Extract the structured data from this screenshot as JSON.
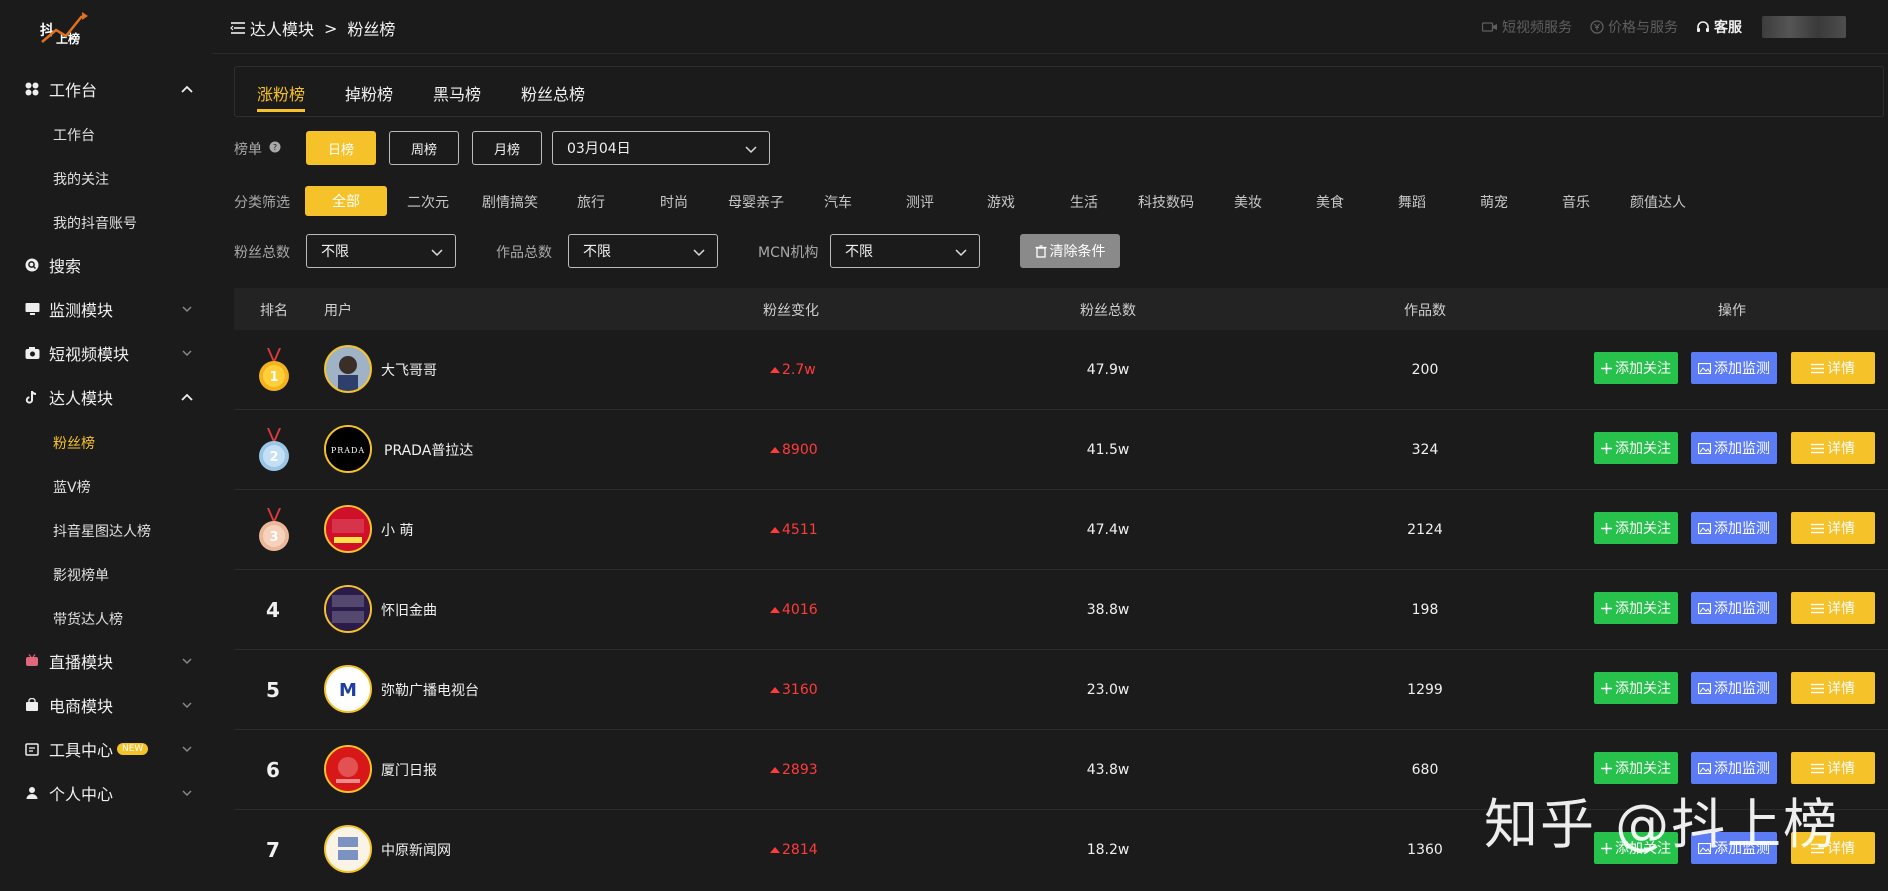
{
  "logo": {
    "line1": "抖",
    "line2": "上榜"
  },
  "sidebar": {
    "sections": [
      {
        "label": "工作台",
        "icon": "grid-icon",
        "expanded": true
      },
      {
        "label": "搜索",
        "icon": "search-icon"
      },
      {
        "label": "监测模块",
        "icon": "monitor-icon",
        "expanded": false
      },
      {
        "label": "短视频模块",
        "icon": "camera-icon",
        "expanded": false
      },
      {
        "label": "达人模块",
        "icon": "tiktok-icon",
        "expanded": true
      },
      {
        "label": "直播模块",
        "icon": "live-icon",
        "expanded": false
      },
      {
        "label": "电商模块",
        "icon": "bag-icon",
        "expanded": false
      },
      {
        "label": "工具中心",
        "icon": "tool-icon",
        "badge": "NEW",
        "expanded": false
      },
      {
        "label": "个人中心",
        "icon": "person-icon",
        "expanded": false
      }
    ],
    "workbench_items": [
      "工作台",
      "我的关注",
      "我的抖音账号"
    ],
    "influencer_items": [
      "粉丝榜",
      "蓝V榜",
      "抖音星图达人榜",
      "影视榜单",
      "带货达人榜"
    ]
  },
  "header": {
    "breadcrumb": [
      "达人模块",
      "粉丝榜"
    ],
    "links": [
      "短视频服务",
      "价格与服务",
      "客服"
    ]
  },
  "tabs": [
    "涨粉榜",
    "掉粉榜",
    "黑马榜",
    "粉丝总榜"
  ],
  "filters": {
    "board_label": "榜单",
    "periods": [
      "日榜",
      "周榜",
      "月榜"
    ],
    "date": "03月04日",
    "category_label": "分类筛选",
    "categories": [
      "全部",
      "二次元",
      "剧情搞笑",
      "旅行",
      "时尚",
      "母婴亲子",
      "汽车",
      "测评",
      "游戏",
      "生活",
      "科技数码",
      "美妆",
      "美食",
      "舞蹈",
      "萌宠",
      "音乐",
      "颜值达人"
    ],
    "fans_label": "粉丝总数",
    "fans_value": "不限",
    "works_label": "作品总数",
    "works_value": "不限",
    "mcn_label": "MCN机构",
    "mcn_value": "不限",
    "clear": "清除条件"
  },
  "table": {
    "headers": [
      "排名",
      "用户",
      "粉丝变化",
      "粉丝总数",
      "作品数",
      "操作"
    ],
    "actions": {
      "follow": "添加关注",
      "monitor": "添加监测",
      "detail": "详情"
    },
    "rows": [
      {
        "rank": "1",
        "name": "大飞哥哥",
        "change": "2.7w",
        "fans": "47.9w",
        "works": "200"
      },
      {
        "rank": "2",
        "name": "PRADA普拉达",
        "change": "8900",
        "fans": "41.5w",
        "works": "324"
      },
      {
        "rank": "3",
        "name": "小 萌",
        "change": "4511",
        "fans": "47.4w",
        "works": "2124"
      },
      {
        "rank": "4",
        "name": "怀旧金曲",
        "change": "4016",
        "fans": "38.8w",
        "works": "198"
      },
      {
        "rank": "5",
        "name": "弥勒广播电视台",
        "change": "3160",
        "fans": "23.0w",
        "works": "1299"
      },
      {
        "rank": "6",
        "name": "厦门日报",
        "change": "2893",
        "fans": "43.8w",
        "works": "680"
      },
      {
        "rank": "7",
        "name": "中原新闻网",
        "change": "2814",
        "fans": "18.2w",
        "works": "1360"
      }
    ]
  },
  "watermark": "知乎 @抖上榜"
}
